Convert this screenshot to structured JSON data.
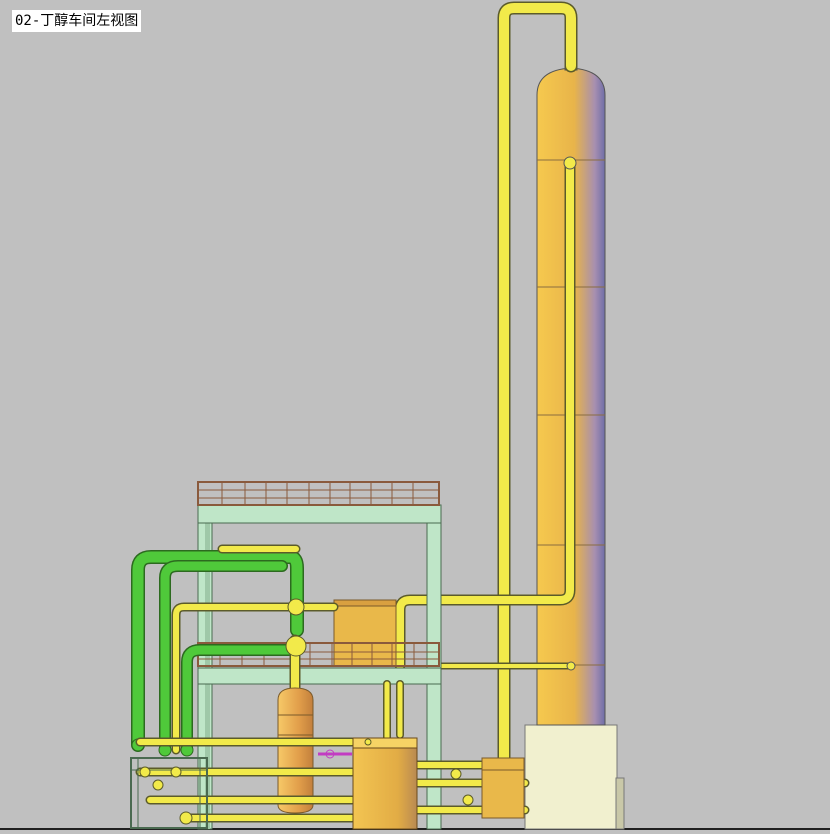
{
  "title": "02-丁醇车间左视图",
  "colors": {
    "background": "#c0c0c0",
    "pipe_yellow": "#f2ea4a",
    "pipe_green": "#4fc93a",
    "vessel_orange": "#e9b84a",
    "frame_green": "#bfe6c8",
    "railing_brown": "#8a5a3c",
    "base_cream": "#f1f0cf"
  }
}
